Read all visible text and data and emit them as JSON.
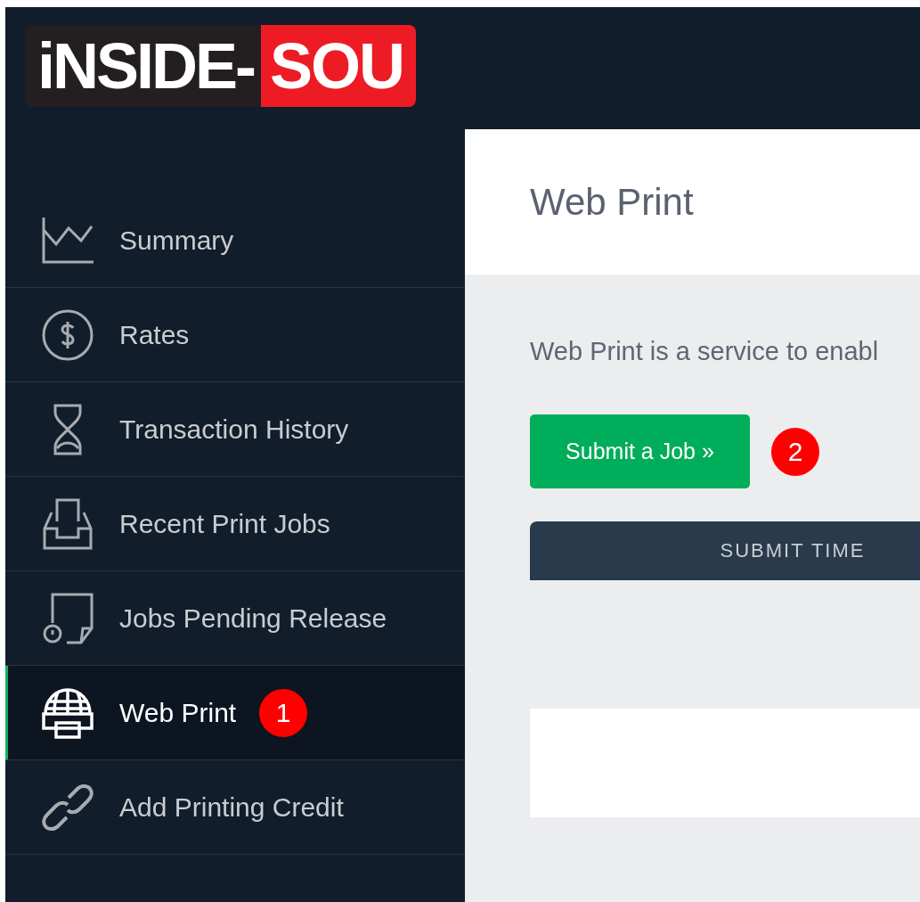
{
  "logo": {
    "text": "iNSIDE-",
    "highlight": "SOU"
  },
  "sidebar": {
    "items": [
      {
        "label": "Summary",
        "kind": "chart",
        "selected": false
      },
      {
        "label": "Rates",
        "kind": "dollar",
        "selected": false
      },
      {
        "label": "Transaction History",
        "kind": "hourglass",
        "selected": false
      },
      {
        "label": "Recent Print Jobs",
        "kind": "tray",
        "selected": false
      },
      {
        "label": "Jobs Pending Release",
        "kind": "pending",
        "selected": false
      },
      {
        "label": "Web Print",
        "kind": "printer",
        "selected": true,
        "badge": "1"
      },
      {
        "label": "Add Printing Credit",
        "kind": "link",
        "selected": false
      }
    ]
  },
  "page": {
    "title": "Web Print",
    "description": "Web Print is a service to enabl",
    "submit_button": {
      "label": "Submit a Job »",
      "badge": "2"
    },
    "table": {
      "columns": [
        "SUBMIT TIME"
      ]
    }
  }
}
